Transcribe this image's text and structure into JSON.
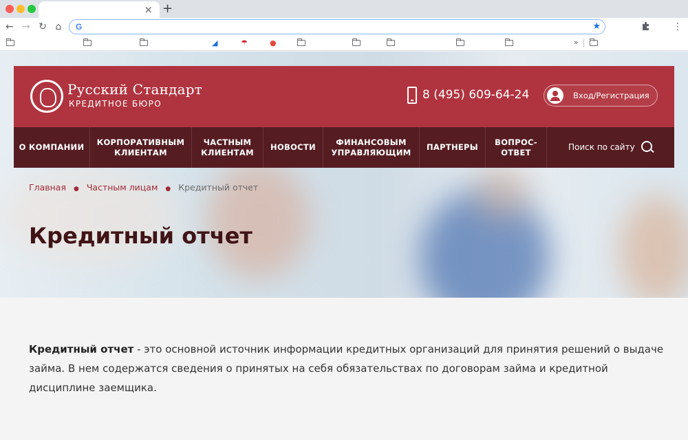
{
  "site": {
    "logo_title": "Русский Стандарт",
    "logo_subtitle": "КРЕДИТНОЕ БЮРО",
    "phone": "8 (495) 609-64-24",
    "login_label": "Вход/Регистрация",
    "brand_color": "#b0343f",
    "nav_color": "#551d22"
  },
  "nav": {
    "items": [
      {
        "label": "О КОМПАНИИ"
      },
      {
        "label": "КОРПОРАТИВНЫМ КЛИЕНТАМ"
      },
      {
        "label": "ЧАСТНЫМ КЛИЕНТАМ"
      },
      {
        "label": "НОВОСТИ"
      },
      {
        "label": "ФИНАНСОВЫМ УПРАВЛЯЮЩИМ"
      },
      {
        "label": "ПАРТНЕРЫ"
      },
      {
        "label": "ВОПРОС-ОТВЕТ"
      }
    ],
    "search_label": "Поиск по сайту"
  },
  "breadcrumb": {
    "home": "Главная",
    "section": "Частным лицам",
    "current": "Кредитный отчет",
    "separator": "●"
  },
  "page": {
    "title": "Кредитный отчет",
    "intro_bold": "Кредитный отчет",
    "intro_text": " - это основной источник информации кредитных организаций для принятия решений о выдаче займа. В нем содержатся сведения о принятых на себя обязательствах по договорам займа и кредитной дисциплине заемщика."
  }
}
